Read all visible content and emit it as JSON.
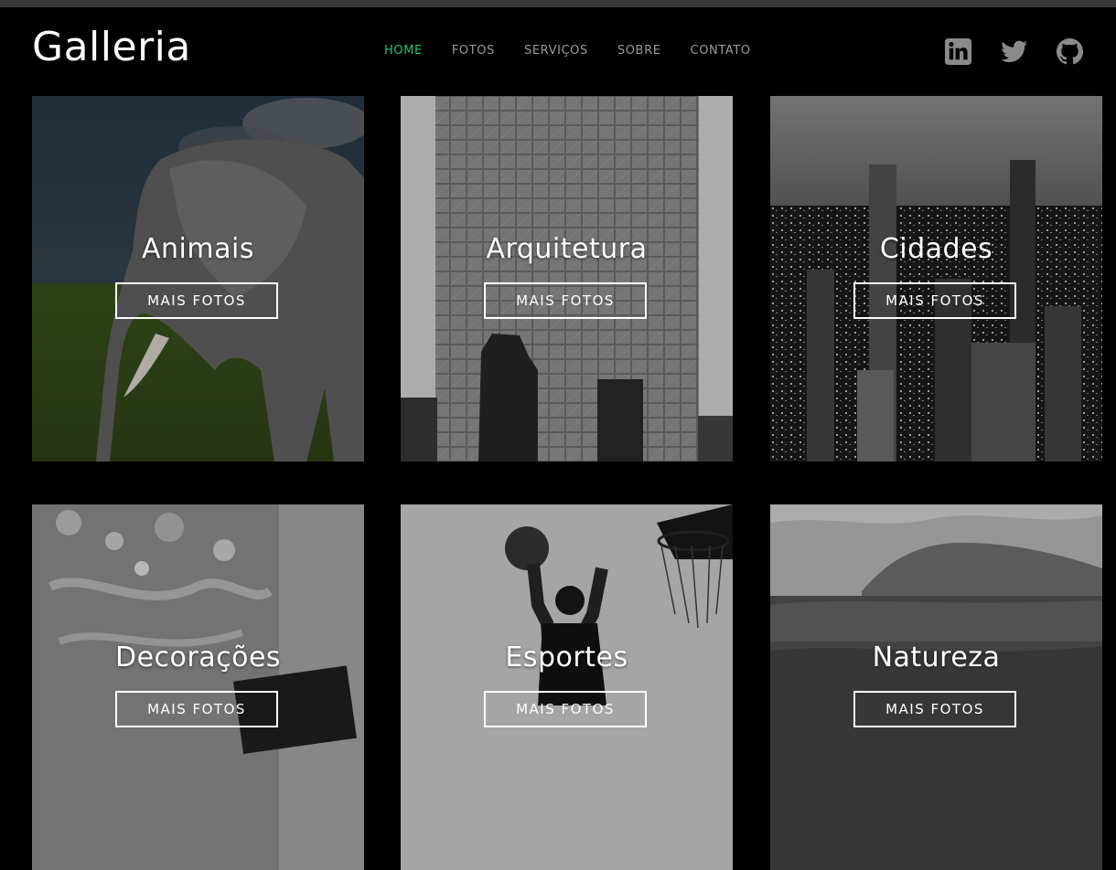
{
  "brand": {
    "logo": "Galleria"
  },
  "nav": {
    "items": [
      {
        "label": "HOME",
        "active": true
      },
      {
        "label": "FOTOS",
        "active": false
      },
      {
        "label": "SERVIÇOS",
        "active": false
      },
      {
        "label": "SOBRE",
        "active": false
      },
      {
        "label": "CONTATO",
        "active": false
      }
    ]
  },
  "social": {
    "icons": [
      "linkedin-icon",
      "twitter-icon",
      "github-icon"
    ]
  },
  "gallery": {
    "button_label": "MAIS FOTOS",
    "cards": [
      {
        "title": "Animais",
        "button": "MAIS FOTOS"
      },
      {
        "title": "Arquitetura",
        "button": "MAIS FOTOS"
      },
      {
        "title": "Cidades",
        "button": "MAIS FOTOS"
      },
      {
        "title": "Decorações",
        "button": "MAIS FOTOS"
      },
      {
        "title": "Esportes",
        "button": "MAIS FOTOS"
      },
      {
        "title": "Natureza",
        "button": "MAIS FOTOS"
      }
    ]
  },
  "colors": {
    "background": "#000000",
    "nav_active": "#2ec26a",
    "nav_inactive": "#9a9a9a",
    "icon": "#8a8a8a"
  }
}
